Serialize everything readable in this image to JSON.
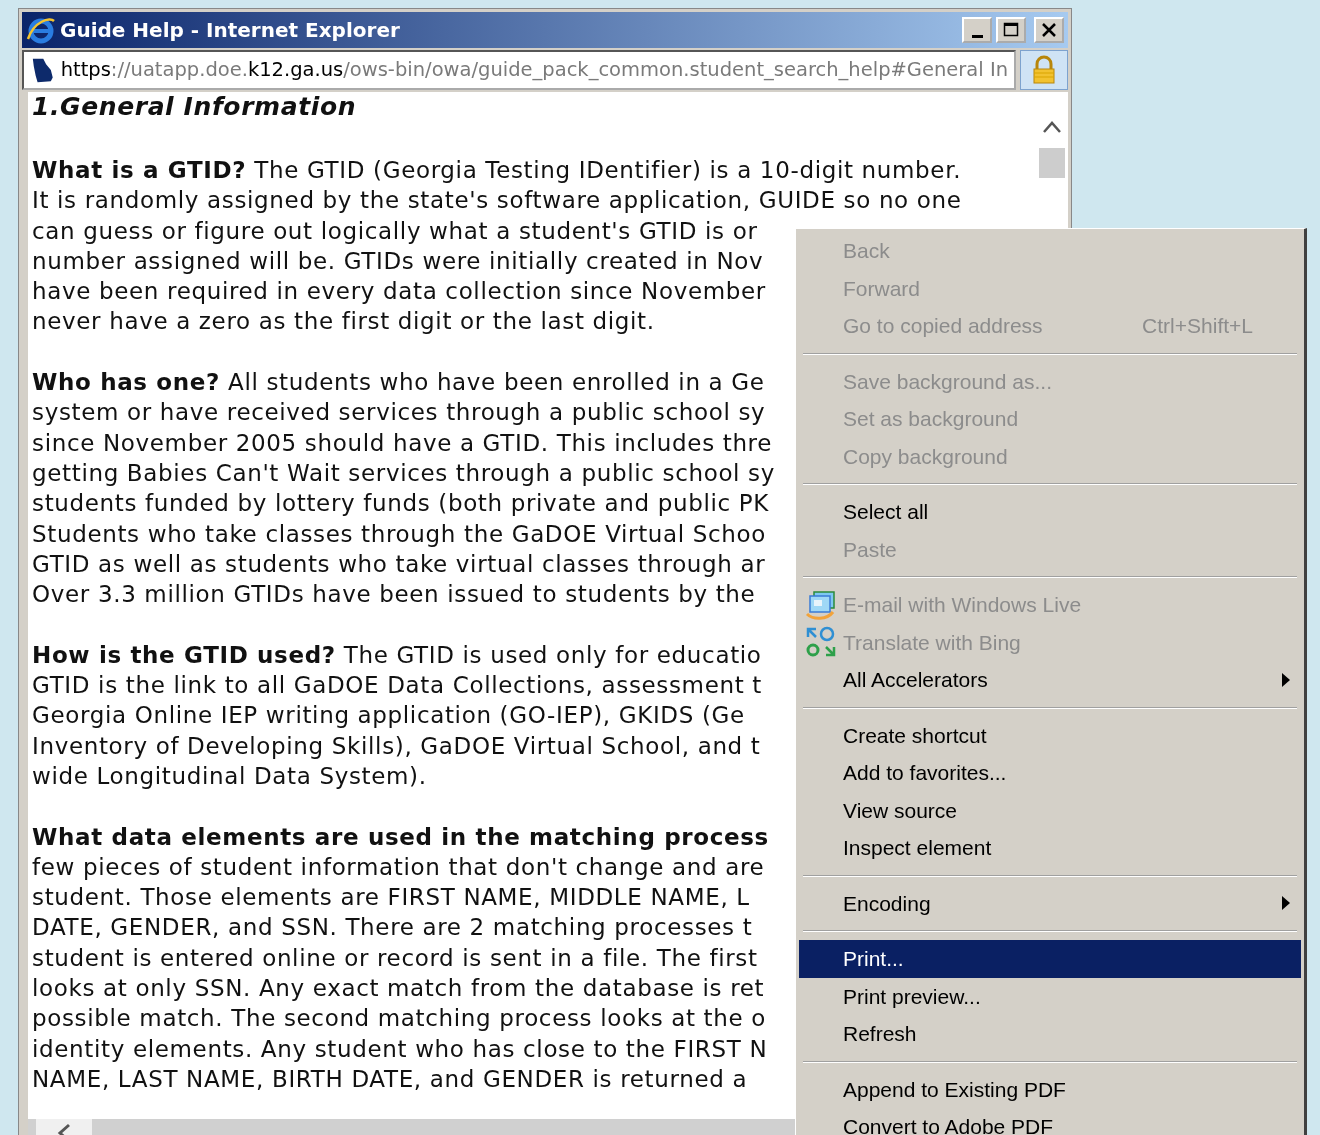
{
  "window": {
    "title": "Guide Help - Internet Explorer",
    "address": [
      {
        "text": "https",
        "emphasized": true
      },
      {
        "text": "://uatapp.doe.",
        "emphasized": false
      },
      {
        "text": "k12.ga.us",
        "emphasized": true
      },
      {
        "text": "/ows-bin/owa/guide_pack_common.student_search_help#General In",
        "emphasized": false
      }
    ]
  },
  "page": {
    "heading": "1.General Information",
    "paragraphs": [
      {
        "lines": [
          "**What is a GTID?** The GTID (Georgia Testing IDentifier) is a 10-digit number.",
          "It is randomly assigned by the state's software application, GUIDE so no one",
          "can guess or figure out logically what a student's GTID is or",
          "number assigned will be. GTIDs were initially created in Nov",
          "have been required in every data collection since November",
          "never have a zero as the first digit or the last digit."
        ]
      },
      {
        "lines": [
          "**Who has one?** All students who have been enrolled in a Ge",
          "system or have received services through a public school sy",
          "since November 2005 should have a GTID. This includes thre",
          "getting Babies Can't Wait services through a public school sy",
          "students funded by lottery funds (both private and public PK",
          "Students who take classes through the GaDOE Virtual Schoo",
          "GTID as well as students who take virtual classes through ar",
          "Over 3.3 million GTIDs have been issued to students by the"
        ]
      },
      {
        "lines": [
          "**How is the GTID used?** The GTID is used only for educatio",
          "GTID is the link to all GaDOE Data Collections, assessment t",
          "Georgia Online IEP writing application (GO-IEP), GKIDS (Ge",
          "Inventory of Developing Skills), GaDOE Virtual School, and t",
          "wide Longitudinal Data System)."
        ]
      },
      {
        "lines": [
          "**What data elements are used in the matching process**",
          "few pieces of student information that don't change and are",
          "student. Those elements are FIRST NAME, MIDDLE NAME, L",
          "DATE, GENDER, and SSN. There are 2 matching processes t",
          "student is entered online or record is sent in a file. The first",
          "looks at only SSN. Any exact match from the database is ret",
          "possible match. The second matching process looks at the o",
          "identity elements. Any student who has close to the FIRST N",
          "NAME, LAST NAME, BIRTH DATE, and GENDER is returned a"
        ]
      }
    ]
  },
  "context_menu": {
    "groups": [
      {
        "items": [
          {
            "label": "Back",
            "kind": "plain",
            "disabled": true,
            "selected": false,
            "submenu": false
          },
          {
            "label": "Forward",
            "kind": "plain",
            "disabled": true,
            "selected": false,
            "submenu": false
          },
          {
            "label": "Go to copied address",
            "shortcut": "Ctrl+Shift+L",
            "kind": "plain",
            "disabled": true,
            "selected": false,
            "submenu": false
          }
        ]
      },
      {
        "items": [
          {
            "label": "Save background as...",
            "kind": "plain",
            "disabled": true,
            "selected": false,
            "submenu": false
          },
          {
            "label": "Set as background",
            "kind": "plain",
            "disabled": true,
            "selected": false,
            "submenu": false
          },
          {
            "label": "Copy background",
            "kind": "plain",
            "disabled": true,
            "selected": false,
            "submenu": false
          }
        ]
      },
      {
        "items": [
          {
            "label": "Select all",
            "kind": "plain",
            "disabled": false,
            "selected": false,
            "submenu": false
          },
          {
            "label": "Paste",
            "kind": "plain",
            "disabled": true,
            "selected": false,
            "submenu": false
          }
        ]
      },
      {
        "items": [
          {
            "label": "E-mail with Windows Live",
            "kind": "email",
            "disabled": true,
            "selected": false,
            "submenu": false
          },
          {
            "label": "Translate with Bing",
            "kind": "translate",
            "disabled": true,
            "selected": false,
            "submenu": false
          },
          {
            "label": "All Accelerators",
            "kind": "plain",
            "disabled": false,
            "selected": false,
            "submenu": true
          }
        ]
      },
      {
        "items": [
          {
            "label": "Create shortcut",
            "kind": "plain",
            "disabled": false,
            "selected": false,
            "submenu": false
          },
          {
            "label": "Add to favorites...",
            "kind": "plain",
            "disabled": false,
            "selected": false,
            "submenu": false
          },
          {
            "label": "View source",
            "kind": "plain",
            "disabled": false,
            "selected": false,
            "submenu": false
          },
          {
            "label": "Inspect element",
            "kind": "plain",
            "disabled": false,
            "selected": false,
            "submenu": false
          }
        ]
      },
      {
        "items": [
          {
            "label": "Encoding",
            "kind": "plain",
            "disabled": false,
            "selected": false,
            "submenu": true
          }
        ]
      },
      {
        "items": [
          {
            "label": "Print...",
            "kind": "plain",
            "disabled": false,
            "selected": true,
            "submenu": false
          },
          {
            "label": "Print preview...",
            "kind": "plain",
            "disabled": false,
            "selected": false,
            "submenu": false
          },
          {
            "label": "Refresh",
            "kind": "plain",
            "disabled": false,
            "selected": false,
            "submenu": false
          }
        ]
      },
      {
        "items": [
          {
            "label": "Append to Existing PDF",
            "kind": "plain",
            "disabled": false,
            "selected": false,
            "submenu": false
          },
          {
            "label": "Convert to Adobe PDF",
            "kind": "plain",
            "disabled": false,
            "selected": false,
            "submenu": false
          }
        ]
      }
    ]
  }
}
